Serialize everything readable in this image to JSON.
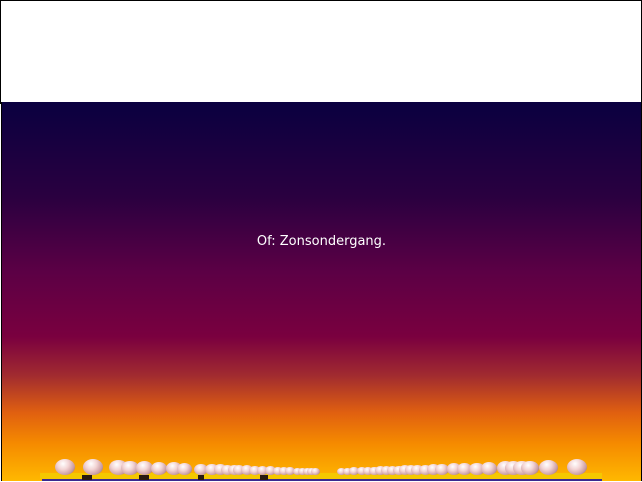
{
  "slide": {
    "caption": "Of: Zonsondergang."
  },
  "colors": {
    "sky_top": "#0a0040",
    "sky_mid": "#7a003f",
    "sky_bottom": "#ffb800"
  }
}
